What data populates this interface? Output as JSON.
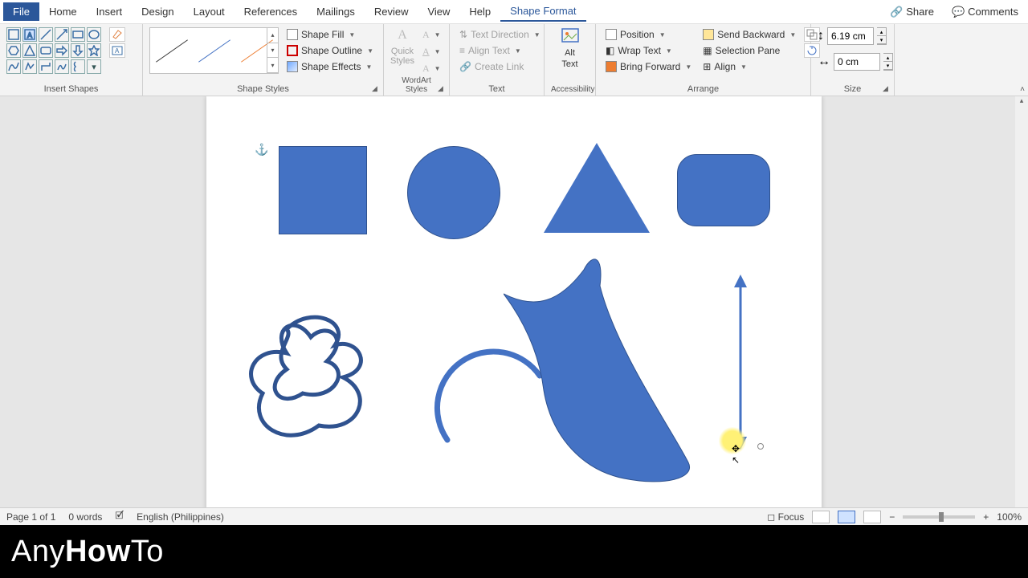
{
  "tabs": {
    "file": "File",
    "home": "Home",
    "insert": "Insert",
    "design": "Design",
    "layout": "Layout",
    "references": "References",
    "mailings": "Mailings",
    "review": "Review",
    "view": "View",
    "help": "Help",
    "shape_format": "Shape Format"
  },
  "topright": {
    "share": "Share",
    "comments": "Comments"
  },
  "ribbon": {
    "insert_shapes_label": "Insert Shapes",
    "shape_styles_label": "Shape Styles",
    "wordart_styles_label": "WordArt Styles",
    "text_label": "Text",
    "accessibility_label": "Accessibility",
    "arrange_label": "Arrange",
    "size_label": "Size",
    "shape_fill": "Shape Fill",
    "shape_outline": "Shape Outline",
    "shape_effects": "Shape Effects",
    "quick_styles": "Quick Styles",
    "text_direction": "Text Direction",
    "align_text": "Align Text",
    "create_link": "Create Link",
    "alt_text_line1": "Alt",
    "alt_text_line2": "Text",
    "position": "Position",
    "wrap_text": "Wrap Text",
    "bring_forward": "Bring Forward",
    "send_backward": "Send Backward",
    "selection_pane": "Selection Pane",
    "align": "Align"
  },
  "size": {
    "height": "6.19 cm",
    "width": "0 cm"
  },
  "status": {
    "page": "Page 1 of 1",
    "words": "0 words",
    "language": "English (Philippines)",
    "focus": "Focus",
    "zoom": "100%"
  },
  "watermark": {
    "part1": "Any",
    "part2": "How",
    "part3": "To"
  }
}
